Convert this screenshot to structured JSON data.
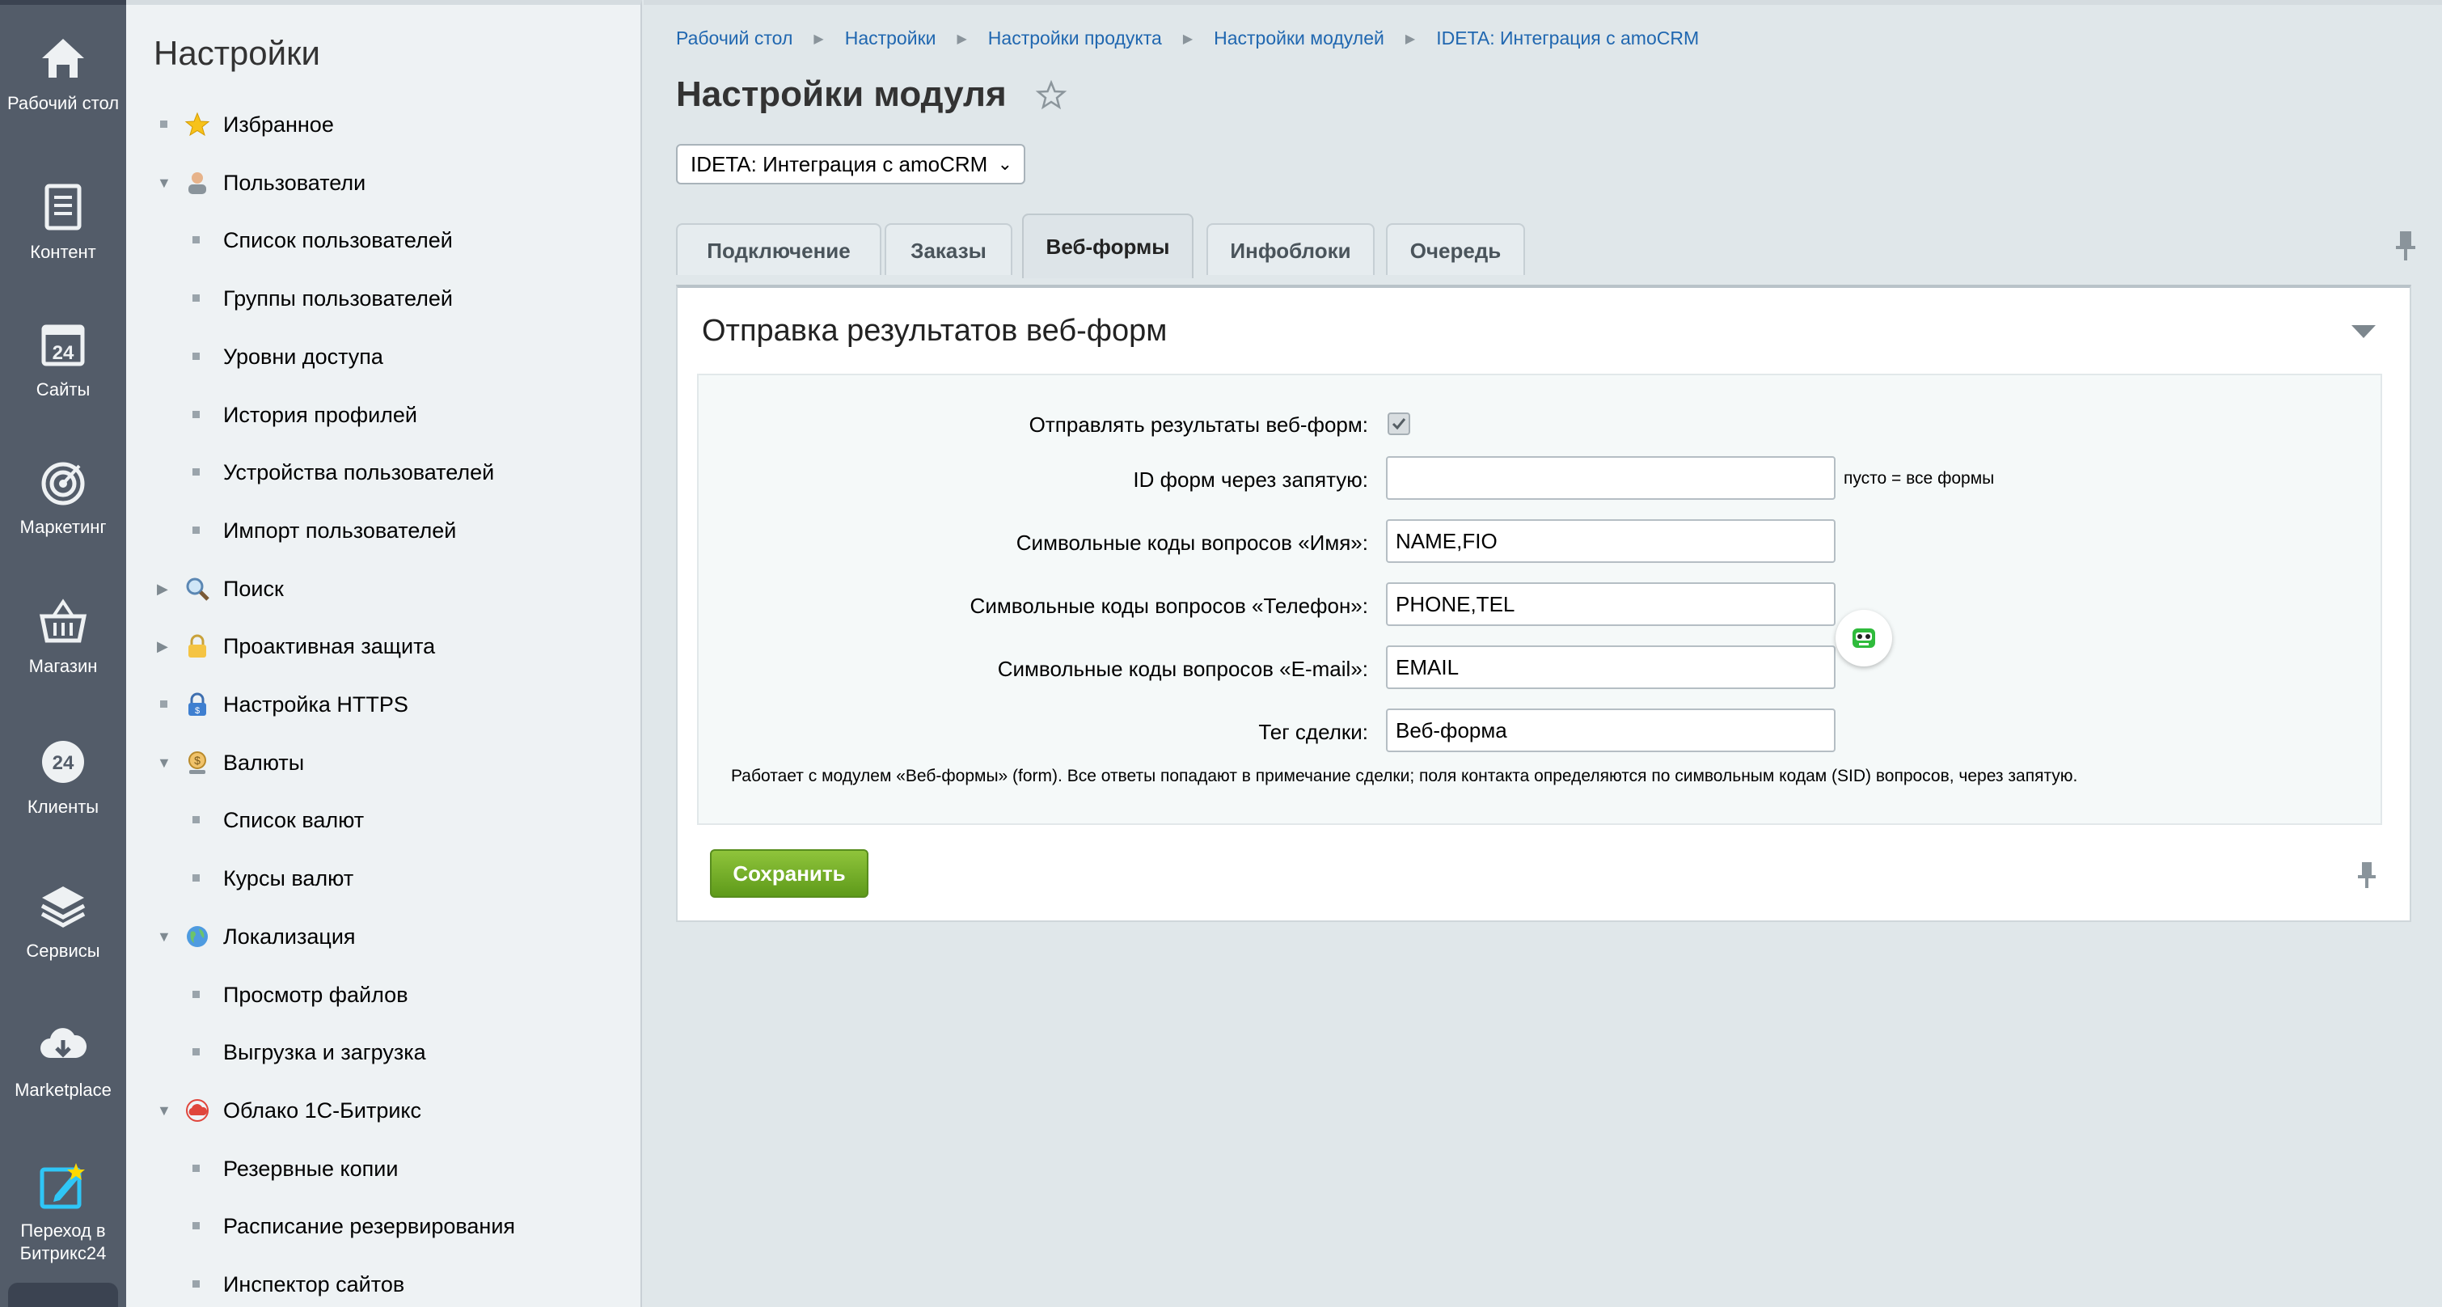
{
  "iconbar": {
    "items": [
      {
        "label": "Рабочий стол",
        "icon": "home-icon"
      },
      {
        "label": "Контент",
        "icon": "document-icon"
      },
      {
        "label": "Сайты",
        "icon": "calendar-24-icon"
      },
      {
        "label": "Маркетинг",
        "icon": "target-icon"
      },
      {
        "label": "Магазин",
        "icon": "basket-icon"
      },
      {
        "label": "Клиенты",
        "icon": "clients-24-icon"
      },
      {
        "label": "Сервисы",
        "icon": "layers-icon"
      },
      {
        "label": "Marketplace",
        "icon": "cloud-download-icon"
      },
      {
        "label": "Переход в Битрикс24",
        "icon": "bitrix24-edit-icon"
      }
    ]
  },
  "menu": {
    "title": "Настройки",
    "items": [
      {
        "label": "Избранное",
        "level": 0,
        "marker": "bullet",
        "icon": "star-icon"
      },
      {
        "label": "Пользователи",
        "level": 0,
        "marker": "expanded",
        "icon": "user-icon"
      },
      {
        "label": "Список пользователей",
        "level": 1,
        "marker": "bullet"
      },
      {
        "label": "Группы пользователей",
        "level": 1,
        "marker": "bullet"
      },
      {
        "label": "Уровни доступа",
        "level": 1,
        "marker": "bullet"
      },
      {
        "label": "История профилей",
        "level": 1,
        "marker": "bullet"
      },
      {
        "label": "Устройства пользователей",
        "level": 1,
        "marker": "bullet"
      },
      {
        "label": "Импорт пользователей",
        "level": 1,
        "marker": "bullet"
      },
      {
        "label": "Поиск",
        "level": 0,
        "marker": "collapsed",
        "icon": "magnifier-icon"
      },
      {
        "label": "Проактивная защита",
        "level": 0,
        "marker": "collapsed",
        "icon": "lock-icon"
      },
      {
        "label": "Настройка HTTPS",
        "level": 0,
        "marker": "bullet",
        "icon": "https-lock-icon"
      },
      {
        "label": "Валюты",
        "level": 0,
        "marker": "expanded",
        "icon": "currency-icon"
      },
      {
        "label": "Список валют",
        "level": 1,
        "marker": "bullet"
      },
      {
        "label": "Курсы валют",
        "level": 1,
        "marker": "bullet"
      },
      {
        "label": "Локализация",
        "level": 0,
        "marker": "expanded",
        "icon": "globe-icon"
      },
      {
        "label": "Просмотр файлов",
        "level": 1,
        "marker": "bullet"
      },
      {
        "label": "Выгрузка и загрузка",
        "level": 1,
        "marker": "bullet"
      },
      {
        "label": "Облако 1С-Битрикс",
        "level": 0,
        "marker": "expanded",
        "icon": "cloud-icon"
      },
      {
        "label": "Резервные копии",
        "level": 1,
        "marker": "bullet"
      },
      {
        "label": "Расписание резервирования",
        "level": 1,
        "marker": "bullet"
      },
      {
        "label": "Инспектор сайтов",
        "level": 1,
        "marker": "bullet"
      }
    ]
  },
  "breadcrumb": [
    "Рабочий стол",
    "Настройки",
    "Настройки продукта",
    "Настройки модулей",
    "IDETA: Интеграция с amoCRM"
  ],
  "page": {
    "title": "Настройки модуля",
    "module_select_value": "IDETA: Интеграция с amoCRM"
  },
  "tabs": [
    {
      "label": "Подключение",
      "active": false
    },
    {
      "label": "Заказы",
      "active": false
    },
    {
      "label": "Веб-формы",
      "active": true
    },
    {
      "label": "Инфоблоки",
      "active": false
    },
    {
      "label": "Очередь",
      "active": false
    }
  ],
  "section": {
    "title": "Отправка результатов веб-форм",
    "fields": {
      "send_label": "Отправлять результаты веб-форм:",
      "send_checked": true,
      "ids_label": "ID форм через запятую:",
      "ids_value": "",
      "ids_hint": "пусто = все формы",
      "name_label": "Символьные коды вопросов «Имя»:",
      "name_value": "NAME,FIO",
      "phone_label": "Символьные коды вопросов «Телефон»:",
      "phone_value": "PHONE,TEL",
      "email_label": "Символьные коды вопросов «E-mail»:",
      "email_value": "EMAIL",
      "tag_label": "Тег сделки:",
      "tag_value": "Веб-форма"
    },
    "note": "Работает с модулем «Веб-формы» (form). Все ответы попадают в примечание сделки; поля контакта определяются по символьным кодам (SID) вопросов, через запятую.",
    "save_label": "Сохранить"
  },
  "colors": {
    "sidebar": "#535c69",
    "link": "#2067b0",
    "save_button": "#6da82a"
  }
}
